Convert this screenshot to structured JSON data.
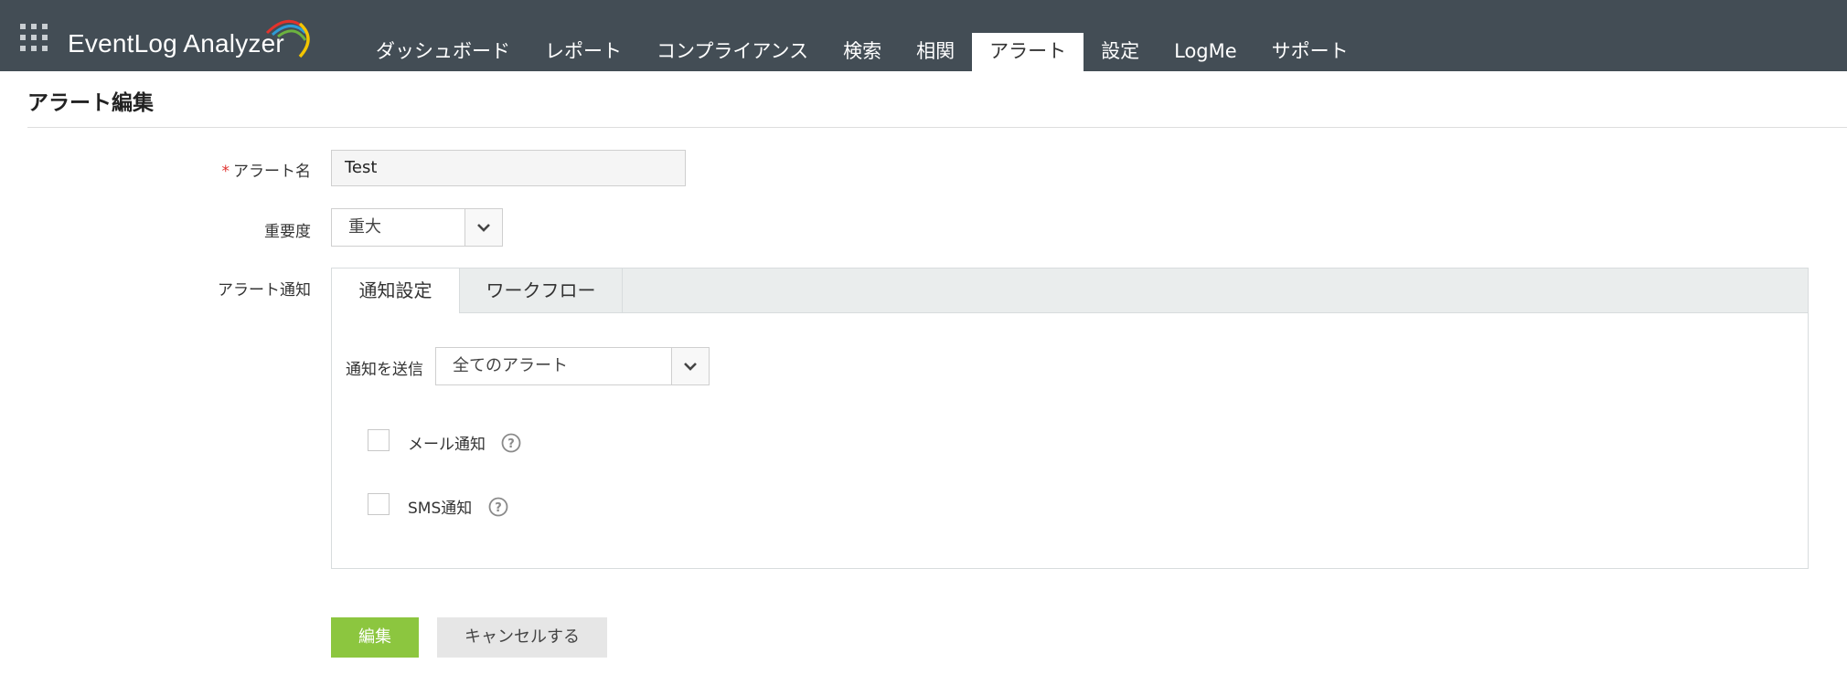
{
  "app": {
    "logo_text": "EventLog Analyzer"
  },
  "nav": {
    "tabs": [
      {
        "label": "ダッシュボード"
      },
      {
        "label": "レポート"
      },
      {
        "label": "コンプライアンス"
      },
      {
        "label": "検索"
      },
      {
        "label": "相関"
      },
      {
        "label": "アラート",
        "active": true
      },
      {
        "label": "設定"
      },
      {
        "label": "LogMe"
      },
      {
        "label": "サポート"
      }
    ]
  },
  "page": {
    "title": "アラート編集"
  },
  "form": {
    "alert_name": {
      "required_mark": "*",
      "label": "アラート名",
      "value": "Test"
    },
    "severity": {
      "label": "重要度",
      "value": "重大"
    },
    "notification": {
      "label": "アラート通知",
      "tabs": [
        {
          "label": "通知設定",
          "active": true
        },
        {
          "label": "ワークフロー"
        }
      ],
      "send": {
        "label": "通知を送信",
        "value": "全てのアラート"
      },
      "email": {
        "label": "メール通知",
        "checked": false
      },
      "sms": {
        "label": "SMS通知",
        "checked": false
      }
    }
  },
  "buttons": {
    "edit": "編集",
    "cancel": "キャンセルする"
  },
  "colors": {
    "topbar": "#434d55",
    "primary_button": "#8cc63f",
    "required": "#e0312e"
  }
}
